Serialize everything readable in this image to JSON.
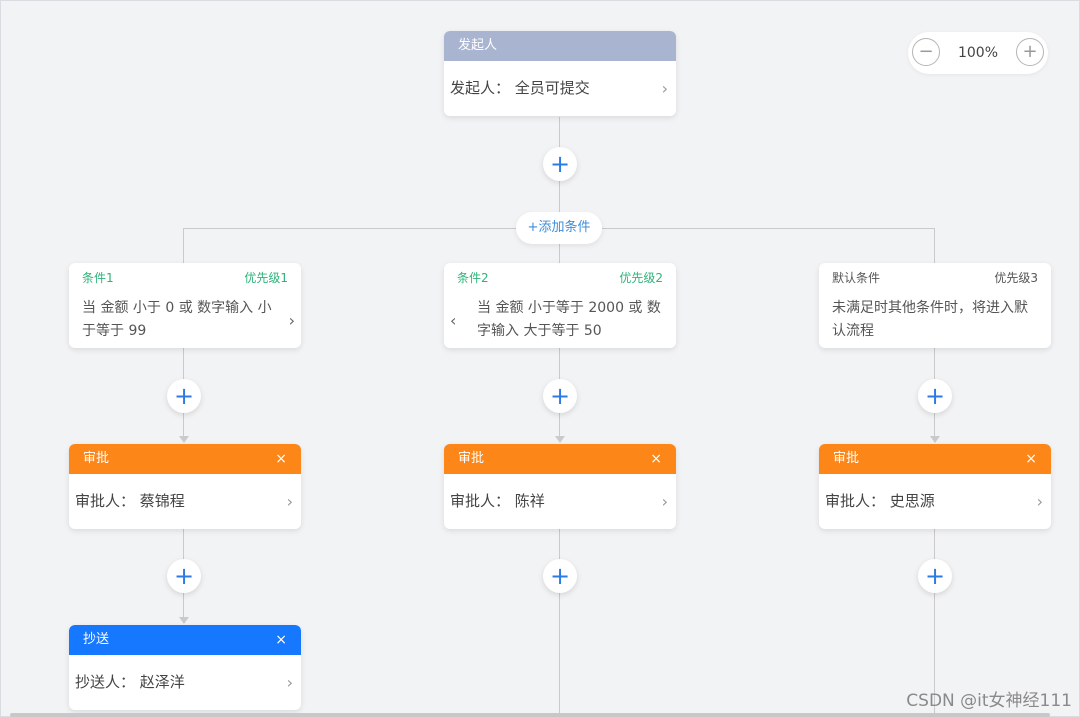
{
  "zoom": {
    "minus": "−",
    "value": "100%",
    "plus": "+"
  },
  "start_node": {
    "header": "发起人",
    "body": "发起人：  全员可提交",
    "chevron": "›"
  },
  "plus": "+",
  "add_condition": "+添加条件",
  "conditions": [
    {
      "name": "条件1",
      "priority": "优先级1",
      "text": "当 金额 小于 0 或 数字输入 小于等于 99",
      "chevron": "›"
    },
    {
      "name": "条件2",
      "priority": "优先级2",
      "text": "当 金额 小于等于 2000 或 数字输入 大于等于 50",
      "chevron": "‹"
    },
    {
      "name": "默认条件",
      "priority": "优先级3",
      "text": "未满足时其他条件时，将进入默认流程",
      "chevron": "›"
    }
  ],
  "approvals": [
    {
      "header": "审批",
      "close": "×",
      "body": "审批人：  蔡锦程",
      "chevron": "›"
    },
    {
      "header": "审批",
      "close": "×",
      "body": "审批人：  陈祥",
      "chevron": "›"
    },
    {
      "header": "审批",
      "close": "×",
      "body": "审批人：  史思源",
      "chevron": "›"
    }
  ],
  "cc_node": {
    "header": "抄送",
    "close": "×",
    "body": "抄送人：  赵泽洋",
    "chevron": "›"
  },
  "watermark": "CSDN @it女神经111",
  "colors": {
    "start": "#a9b4d1",
    "approve": "#fc8618",
    "cc": "#1677ff",
    "condition_green": "#2fb37a",
    "plus_blue": "#2c7be5"
  }
}
